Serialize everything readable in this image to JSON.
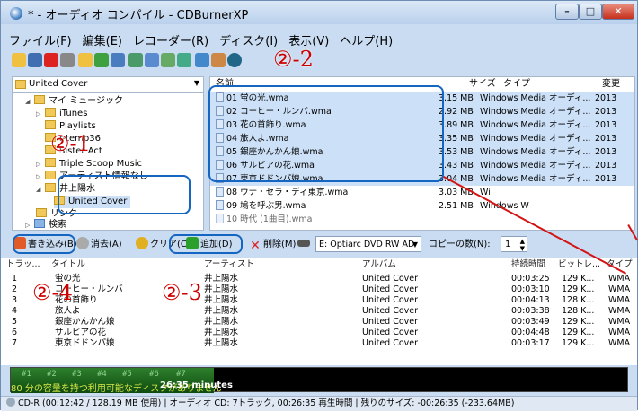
{
  "window": {
    "title": "* - オーディオ コンパイル - CDBurnerXP",
    "min": "–",
    "max": "□",
    "close": "✕"
  },
  "menu": [
    "ファイル(F)",
    "編集(E)",
    "レコーダー(R)",
    "ディスク(I)",
    "表示(V)",
    "ヘルプ(H)"
  ],
  "tree": {
    "combo": "United Cover",
    "nodes": [
      {
        "label": "マイ ミュージック",
        "arrow": "◢"
      },
      {
        "label": "iTunes",
        "arrow": "▷"
      },
      {
        "label": "Playlists",
        "arrow": ""
      },
      {
        "label": "r-temp36",
        "arrow": ""
      },
      {
        "label": "Sister Act",
        "arrow": ""
      },
      {
        "label": "Triple Scoop Music",
        "arrow": "▷"
      },
      {
        "label": "アーティスト情報なし",
        "arrow": "▷"
      },
      {
        "label": "井上陽水",
        "arrow": "◢"
      },
      {
        "label": "United Cover",
        "arrow": ""
      },
      {
        "label": "リンク",
        "arrow": ""
      },
      {
        "label": "検索",
        "arrow": "▷"
      }
    ]
  },
  "filelist": {
    "headers": {
      "name": "名前",
      "size": "サイズ",
      "type": "タイプ",
      "date": "変更"
    },
    "rows": [
      {
        "name": "01 蛍の光.wma",
        "size": "3.15 MB",
        "type": "Windows Media オーディ...",
        "date": "2013"
      },
      {
        "name": "02 コーヒー・ルンバ.wma",
        "size": "2.92 MB",
        "type": "Windows Media オーディ...",
        "date": "2013"
      },
      {
        "name": "03 花の首飾り.wma",
        "size": "3.89 MB",
        "type": "Windows Media オーディ...",
        "date": "2013"
      },
      {
        "name": "04 旅人よ.wma",
        "size": "3.35 MB",
        "type": "Windows Media オーディ...",
        "date": "2013"
      },
      {
        "name": "05 銀座かんかん娘.wma",
        "size": "3.53 MB",
        "type": "Windows Media オーディ...",
        "date": "2013"
      },
      {
        "name": "06 サルビアの花.wma",
        "size": "3.43 MB",
        "type": "Windows Media オーディ...",
        "date": "2013"
      },
      {
        "name": "07 東京ドドンパ娘.wma",
        "size": "3.04 MB",
        "type": "Windows Media オーディ...",
        "date": "2013"
      },
      {
        "name": "08 ウナ・セラ・ディ東京.wma",
        "size": "3.03 MB",
        "type": "Wi",
        "date": ""
      },
      {
        "name": "09 鳩を呼ぶ男.wma",
        "size": "2.51 MB",
        "type": "Windows W",
        "date": ""
      },
      {
        "name": "10 時代 (1曲目).wma",
        "size": "",
        "type": "",
        "date": ""
      }
    ]
  },
  "actions": {
    "burn": "書き込み(B)",
    "erase": "消去(A)",
    "clear": "クリア(C)",
    "add": "追加(D)",
    "delete": "削除(M)",
    "drive": "E: Optiarc DVD RW AD",
    "copies_label": "コピーの数(N):",
    "copies": "1"
  },
  "tracks": {
    "headers": [
      "トラッ...",
      "タイトル",
      "アーティスト",
      "アルバム",
      "持続時間",
      "ビットレ...",
      "タイプ"
    ],
    "rows": [
      [
        "1",
        "蛍の光",
        "井上陽水",
        "United Cover",
        "00:03:25",
        "129 K...",
        "WMA"
      ],
      [
        "2",
        "コーヒー・ルンバ",
        "井上陽水",
        "United Cover",
        "00:03:10",
        "129 K...",
        "WMA"
      ],
      [
        "3",
        "花の首飾り",
        "井上陽水",
        "United Cover",
        "00:04:13",
        "128 K...",
        "WMA"
      ],
      [
        "4",
        "旅人よ",
        "井上陽水",
        "United Cover",
        "00:03:38",
        "128 K...",
        "WMA"
      ],
      [
        "5",
        "銀座かんかん娘",
        "井上陽水",
        "United Cover",
        "00:03:49",
        "129 K...",
        "WMA"
      ],
      [
        "6",
        "サルビアの花",
        "井上陽水",
        "United Cover",
        "00:04:48",
        "129 K...",
        "WMA"
      ],
      [
        "7",
        "東京ドドンパ娘",
        "井上陽水",
        "United Cover",
        "00:03:17",
        "129 K...",
        "WMA"
      ]
    ]
  },
  "meter": {
    "segments": [
      "#1",
      "#2",
      "#3",
      "#4",
      "#5",
      "#6",
      "#7"
    ],
    "caption": "80 分の容量を持つ利用可能なディスクがありません",
    "minutes": "26:35 minutes",
    "fill_fraction": 0.33
  },
  "status": "CD-R (00:12:42 / 128.19 MB 使用) | オーディオ CD: 7トラック, 00:26:35 再生時間 | 残りのサイズ: -00:26:35 (-233.64MB)",
  "annotations": {
    "a1": "②-1",
    "a2": "②-2",
    "a3": "②-3",
    "a4": "②-4"
  },
  "colors": {
    "callout": "#1466c0",
    "annotation": "#cc0000",
    "selection": "#cce0f7"
  }
}
